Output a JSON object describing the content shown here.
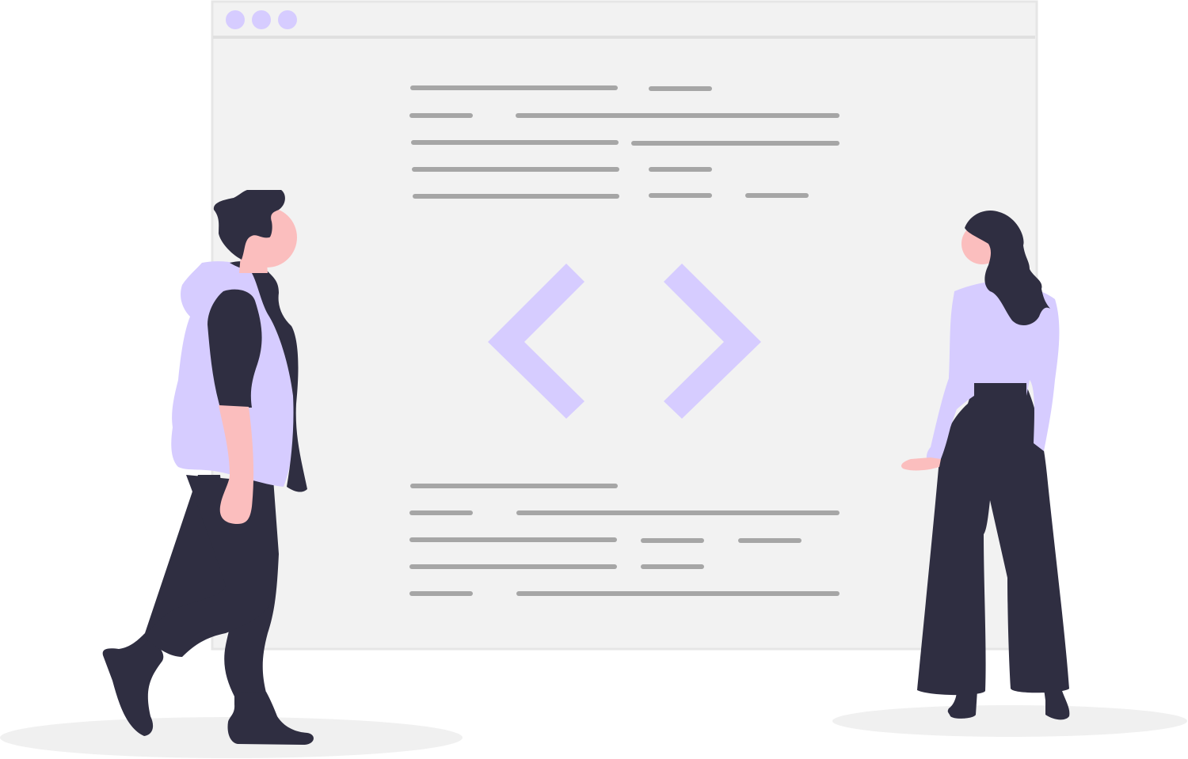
{
  "illustration": {
    "subject": "coding-illustration",
    "colors": {
      "accent": "#d6ccff",
      "window_bg": "#f2f2f2",
      "window_border": "#e6e6e6",
      "line": "#a6a6a6",
      "dark": "#2f2e41",
      "skin": "#fbbebe",
      "shadow": "#f0f0f0"
    },
    "window": {
      "control_dots": [
        {
          "name": "control-dot-1",
          "color": "#d6ccff"
        },
        {
          "name": "control-dot-2",
          "color": "#d6ccff"
        },
        {
          "name": "control-dot-3",
          "color": "#d6ccff"
        }
      ],
      "center_icon": "code-brackets-icon"
    },
    "figures": [
      {
        "name": "man-figure",
        "icon": "man-walking-icon"
      },
      {
        "name": "woman-figure",
        "icon": "woman-standing-icon"
      }
    ]
  }
}
